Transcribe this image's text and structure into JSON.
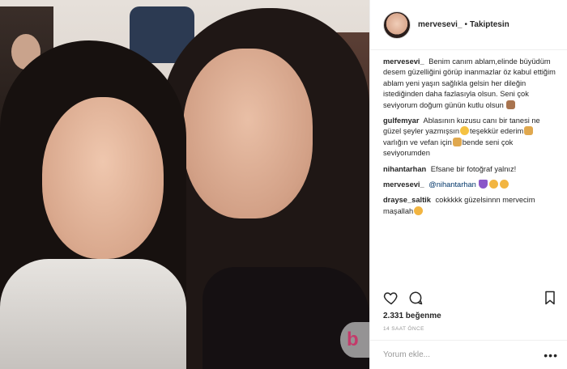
{
  "post": {
    "header": {
      "username": "mervesevi_",
      "separator": "•",
      "follow_status": "Takiptesin"
    },
    "comments": [
      {
        "user": "mervesevi_",
        "text": "Benim canım ablam,elinde büyüdüm desem güzelliğini görüp inanmazlar öz kabul ettiğim ablam yeni yaşın sağlıkla gelsin her dileğin istediğinden daha fazlasıyla olsun. Seni çok seviyorum doğum günün kutlu olsun",
        "emojis": [
          "cake"
        ]
      },
      {
        "user": "gulfemyar",
        "text_a": "Ablasının kuzusu canı bir tanesi ne güzel şeyler yazmışsın",
        "text_b": "teşekkür ederim",
        "text_c": "varlığın ve vefan için",
        "text_d": "bende seni çok seviyorumden"
      },
      {
        "user": "nihantarhan",
        "text": "Efsane bir fotoğraf yalnız!"
      },
      {
        "user": "mervesevi_",
        "mention": "@nihantarhan"
      },
      {
        "user": "drayse_saltik",
        "text": "cokkkkk güzelsinnn mervecim maşallah"
      }
    ],
    "likes": "2.331 beğenme",
    "timestamp": "14 SAAT ÖNCE",
    "add_comment_placeholder": "Yorum ekle...",
    "more_options": "•••"
  },
  "icons": {
    "like": "heart-outline-icon",
    "comment": "speech-bubble-icon",
    "save": "bookmark-icon"
  },
  "colors": {
    "text": "#262626",
    "muted": "#999999",
    "mention": "#003569",
    "border": "#efefef"
  }
}
